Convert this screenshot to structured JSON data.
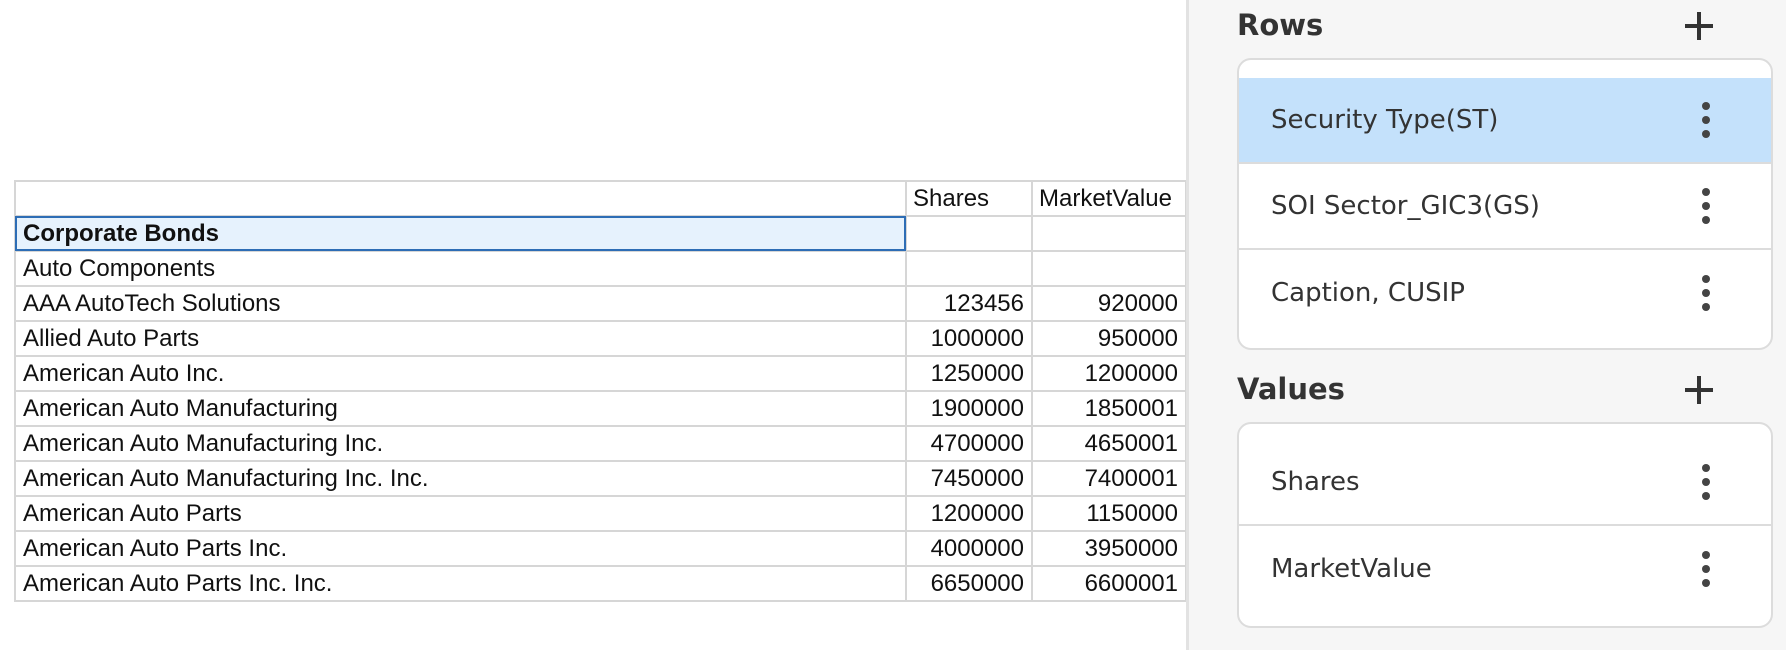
{
  "grid": {
    "header": {
      "col1": "",
      "col2": "Shares",
      "col3": "MarketValue"
    },
    "rows": [
      {
        "label": "Corporate Bonds",
        "shares": "",
        "market_value": ""
      },
      {
        "label": "Auto Components",
        "shares": "",
        "market_value": ""
      },
      {
        "label": "AAA AutoTech Solutions",
        "shares": "123456",
        "market_value": "920000"
      },
      {
        "label": "Allied Auto Parts",
        "shares": "1000000",
        "market_value": "950000"
      },
      {
        "label": "American Auto Inc.",
        "shares": "1250000",
        "market_value": "1200000"
      },
      {
        "label": "American Auto Manufacturing",
        "shares": "1900000",
        "market_value": "1850001"
      },
      {
        "label": "American Auto Manufacturing Inc.",
        "shares": "4700000",
        "market_value": "4650001"
      },
      {
        "label": "American Auto Manufacturing Inc. Inc.",
        "shares": "7450000",
        "market_value": "7400001"
      },
      {
        "label": "American Auto Parts",
        "shares": "1200000",
        "market_value": "1150000"
      },
      {
        "label": "American Auto Parts Inc.",
        "shares": "4000000",
        "market_value": "3950000"
      },
      {
        "label": "American Auto Parts Inc. Inc.",
        "shares": "6650000",
        "market_value": "6600001"
      }
    ]
  },
  "panel": {
    "rows": {
      "title": "Rows",
      "items": [
        {
          "label": "Security Type(ST)",
          "selected": true
        },
        {
          "label": "SOI Sector_GIC3(GS)",
          "selected": false
        },
        {
          "label": "Caption, CUSIP",
          "selected": false
        }
      ]
    },
    "values": {
      "title": "Values",
      "items": [
        {
          "label": "Shares"
        },
        {
          "label": "MarketValue"
        }
      ]
    }
  },
  "icons": {
    "add": "plus-icon",
    "item_menu": "kebab-menu-icon"
  },
  "colors": {
    "selected_row": "#c4e1fb",
    "selected_cell": "#e6f2fd",
    "selected_cell_border": "#2d6db5"
  }
}
